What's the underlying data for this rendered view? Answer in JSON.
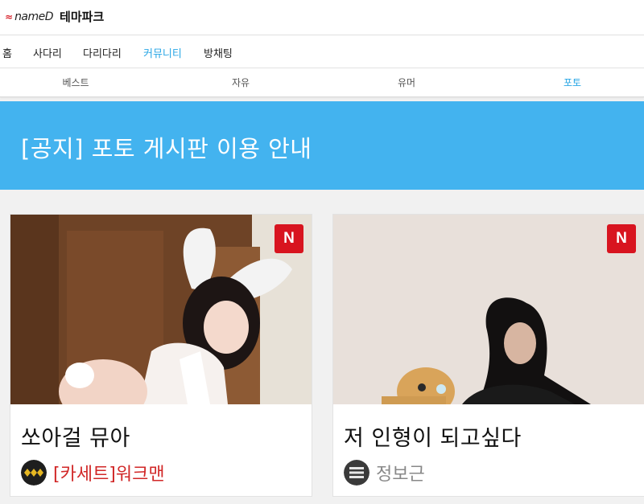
{
  "header": {
    "logo_mark": "≈",
    "logo_text": "nameD",
    "title": "테마파크"
  },
  "mainnav": [
    {
      "label": "홈",
      "active": false
    },
    {
      "label": "사다리",
      "active": false
    },
    {
      "label": "다리다리",
      "active": false
    },
    {
      "label": "커뮤니티",
      "active": true
    },
    {
      "label": "방채팅",
      "active": false
    }
  ],
  "subnav": [
    {
      "label": "베스트",
      "active": false
    },
    {
      "label": "자유",
      "active": false
    },
    {
      "label": "유머",
      "active": false
    },
    {
      "label": "포토",
      "active": true
    }
  ],
  "notice": {
    "text": "[공지] 포토 게시판 이용 안내"
  },
  "posts": [
    {
      "badge": "N",
      "title": "쏘아걸 뮤아",
      "author": "[카세트]워크맨",
      "author_color": "#d12727",
      "avatar_icon": "triple-diamond-rank-icon"
    },
    {
      "badge": "N",
      "title": "저 인형이 되고싶다",
      "author": "정보근",
      "author_color": "#888888",
      "avatar_icon": "list-rank-icon"
    }
  ],
  "colors": {
    "accent": "#28a6e5",
    "notice_bg": "#43b3ef",
    "badge_red": "#d8141f"
  }
}
